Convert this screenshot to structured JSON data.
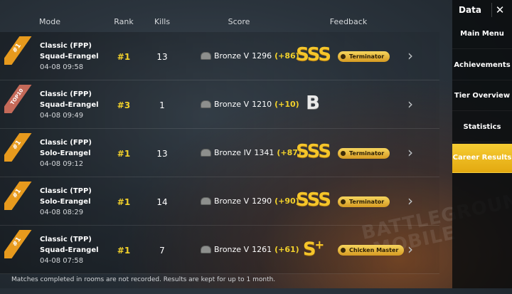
{
  "header": {
    "mode": "Mode",
    "rank": "Rank",
    "kills": "Kills",
    "score": "Score",
    "feedback": "Feedback"
  },
  "matches": [
    {
      "ribbon": "#1",
      "mode": "Classic (FPP)",
      "map": "Squad-Erangel",
      "date": "04-08 09:58",
      "rank": "#1",
      "kills": "13",
      "tier": "Bronze V",
      "score": "1296",
      "delta": "(+86)",
      "grade": "SSS",
      "title": "Terminator"
    },
    {
      "ribbon": "TOP10",
      "mode": "Classic (FPP)",
      "map": "Squad-Erangel",
      "date": "04-08 09:49",
      "rank": "#3",
      "kills": "1",
      "tier": "Bronze V",
      "score": "1210",
      "delta": "(+10)",
      "grade": "B",
      "title": ""
    },
    {
      "ribbon": "#1",
      "mode": "Classic (FPP)",
      "map": "Solo-Erangel",
      "date": "04-08 09:12",
      "rank": "#1",
      "kills": "13",
      "tier": "Bronze IV",
      "score": "1341",
      "delta": "(+87)",
      "grade": "SSS",
      "title": "Terminator"
    },
    {
      "ribbon": "#1",
      "mode": "Classic (TPP)",
      "map": "Solo-Erangel",
      "date": "04-08 08:29",
      "rank": "#1",
      "kills": "14",
      "tier": "Bronze V",
      "score": "1290",
      "delta": "(+90)",
      "grade": "SSS",
      "title": "Terminator"
    },
    {
      "ribbon": "#1",
      "mode": "Classic (TPP)",
      "map": "Squad-Erangel",
      "date": "04-08 07:58",
      "rank": "#1",
      "kills": "7",
      "tier": "Bronze V",
      "score": "1261",
      "delta": "(+61)",
      "grade": "S",
      "grade_sup": "+",
      "title": "Chicken Master"
    }
  ],
  "footer": "Matches completed in rooms are not recorded. Results are kept for up to 1 month.",
  "sidebar": {
    "title": "Data",
    "close": "✕",
    "items": [
      {
        "label": "Main Menu"
      },
      {
        "label": "Achievements"
      },
      {
        "label": "Tier Overview"
      },
      {
        "label": "Statistics"
      },
      {
        "label": "Career Results",
        "active": true
      }
    ]
  },
  "background_watermark": "BATTLEGROUNDS MOBILE",
  "colors": {
    "gold": "#f2d12b",
    "accent": "#e3a910",
    "ribbon_gold": "#e79a1d",
    "ribbon_top10": "#c56a59"
  }
}
